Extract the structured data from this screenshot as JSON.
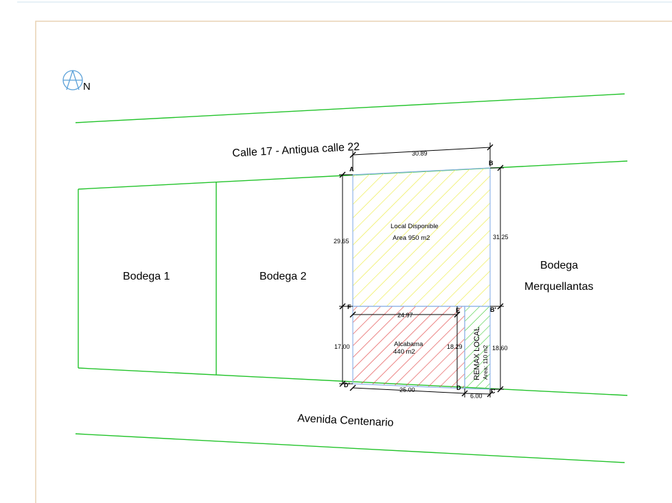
{
  "compass": {
    "label": "N",
    "icon": "north-arrow-icon"
  },
  "streets": {
    "top": "Calle 17 - Antigua calle 22",
    "bottom": "Avenida Centenario"
  },
  "parcels": {
    "bodega1": "Bodega 1",
    "bodega2": "Bodega 2",
    "merquellantas_line1": "Bodega",
    "merquellantas_line2": "Merquellantas",
    "local_line1": "Local Disponible",
    "local_line2": "Area 950 m2",
    "alcabama_line1": "Alcabama",
    "alcabama_line2": "440 m2",
    "remax_line1": "REMAX LOCAL",
    "remax_line2": "Area: 110 m2"
  },
  "dimensions": {
    "top": "30.89",
    "left_upper": "29.65",
    "right_upper": "31.25",
    "middle": "24.97",
    "left_lower": "17.00",
    "right_lower": "18.60",
    "inner": "18.29",
    "bottom": "25.00",
    "bottom_small": "6.00"
  },
  "points": {
    "a": "A",
    "b": "B",
    "f": "F",
    "e": "E",
    "b2": "B'",
    "d1": "D'",
    "d": "D",
    "c": "C"
  },
  "colors": {
    "street_line": "#22c32a",
    "frame": "#e8d2b4",
    "parcel_outline": "#8fb4e8",
    "local_hatch": "#f0ef55",
    "alcabama_hatch": "#e03a3a",
    "remax_hatch": "#42cc3a",
    "dim_line": "#000000"
  }
}
